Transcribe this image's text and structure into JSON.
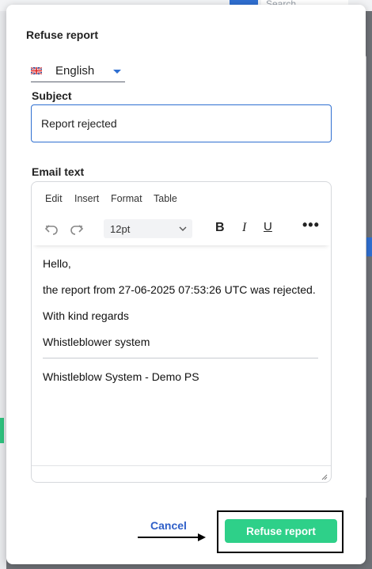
{
  "background": {
    "search_placeholder": "Search"
  },
  "modal": {
    "title": "Refuse report",
    "language": {
      "selected": "English",
      "flag_icon": "uk-flag-icon"
    },
    "subject": {
      "label": "Subject",
      "value": "Report rejected"
    },
    "email": {
      "label": "Email text",
      "menubar": [
        "Edit",
        "Insert",
        "Format",
        "Table"
      ],
      "toolbar": {
        "undo_icon": "undo-icon",
        "redo_icon": "redo-icon",
        "font_size": "12pt",
        "bold": "B",
        "italic": "I",
        "underline": "U",
        "more": "•••"
      },
      "body": {
        "greeting": "Hello,",
        "message": "the report from 27-06-2025 07:53:26 UTC was rejected.",
        "closing": "With kind regards",
        "sender": "Whistleblower system",
        "signature": "Whistleblow System - Demo PS"
      }
    },
    "actions": {
      "cancel": "Cancel",
      "refuse": "Refuse report"
    }
  },
  "colors": {
    "accent": "#2f6fd1",
    "primary_button": "#2ed089",
    "overlay": "#6f7277"
  }
}
